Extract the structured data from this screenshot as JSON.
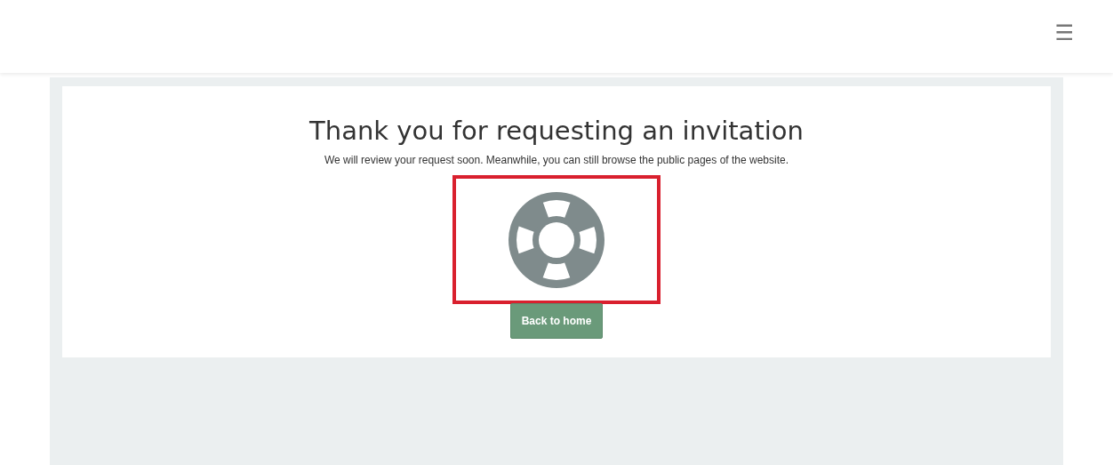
{
  "header": {
    "menu_icon": "☰"
  },
  "card": {
    "title": "Thank you for requesting an invitation",
    "message": "We will review your request soon. Meanwhile, you can still browse the public pages of the website.",
    "illustration": {
      "highlighted": true
    },
    "button": "Back to home"
  }
}
